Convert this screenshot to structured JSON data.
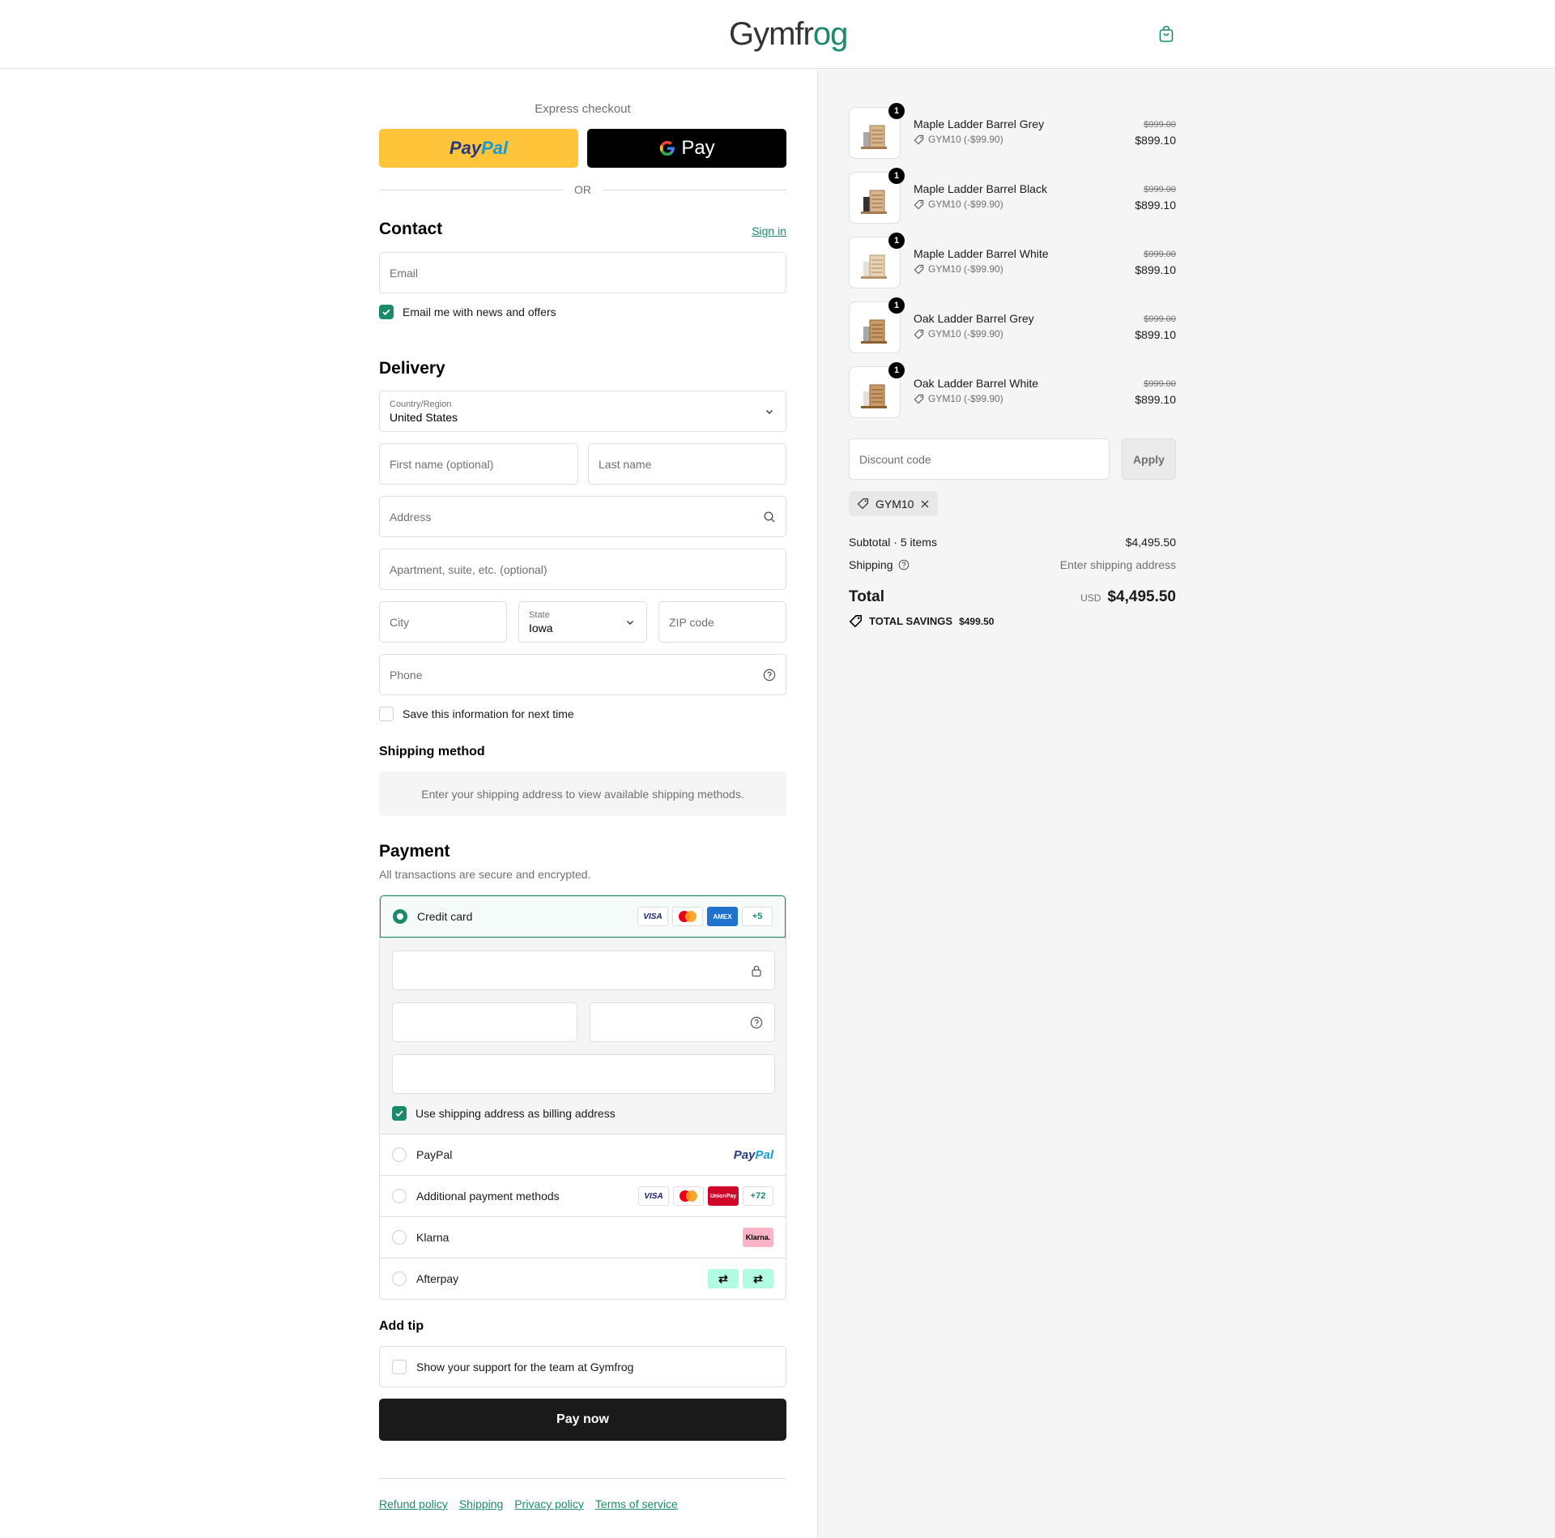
{
  "header": {
    "brand_prefix": "Gymfr",
    "brand_suffix": "og",
    "cart_icon": "shopping-bag-icon"
  },
  "express": {
    "label": "Express checkout",
    "paypal_part1": "Pay",
    "paypal_part2": "Pal",
    "gpay_label": "Pay",
    "or_text": "OR"
  },
  "contact": {
    "title": "Contact",
    "sign_in": "Sign in",
    "email_placeholder": "Email",
    "newsletter_label": "Email me with news and offers",
    "newsletter_checked": true
  },
  "delivery": {
    "title": "Delivery",
    "country_label": "Country/Region",
    "country_value": "United States",
    "first_name_placeholder": "First name (optional)",
    "last_name_placeholder": "Last name",
    "address_placeholder": "Address",
    "apartment_placeholder": "Apartment, suite, etc. (optional)",
    "city_placeholder": "City",
    "state_label": "State",
    "state_value": "Iowa",
    "zip_placeholder": "ZIP code",
    "phone_placeholder": "Phone",
    "save_info_label": "Save this information for next time",
    "save_info_checked": false
  },
  "shipping_method": {
    "title": "Shipping method",
    "message": "Enter your shipping address to view available shipping methods."
  },
  "payment": {
    "title": "Payment",
    "note": "All transactions are secure and encrypted.",
    "credit_card_label": "Credit card",
    "credit_card_more": "+5",
    "billing_label": "Use shipping address as billing address",
    "billing_checked": true,
    "paypal_label": "PayPal",
    "paypal_brand": "PayPal",
    "additional_label": "Additional payment methods",
    "additional_more": "+72",
    "klarna_label": "Klarna",
    "klarna_brand": "Klarna.",
    "afterpay_label": "Afterpay",
    "visa": "VISA",
    "amex": "AMEX",
    "unionpay": "UnionPay"
  },
  "tip": {
    "title": "Add tip",
    "label": "Show your support for the team at Gymfrog"
  },
  "pay_now": "Pay now",
  "footer_links": [
    "Refund policy",
    "Shipping",
    "Privacy policy",
    "Terms of service"
  ],
  "order": {
    "items": [
      {
        "name": "Maple Ladder Barrel Grey",
        "discount": "GYM10 (-$99.90)",
        "original": "$999.00",
        "price": "$899.10",
        "qty": "1"
      },
      {
        "name": "Maple Ladder Barrel Black",
        "discount": "GYM10 (-$99.90)",
        "original": "$999.00",
        "price": "$899.10",
        "qty": "1"
      },
      {
        "name": "Maple Ladder Barrel White",
        "discount": "GYM10 (-$99.90)",
        "original": "$999.00",
        "price": "$899.10",
        "qty": "1"
      },
      {
        "name": "Oak Ladder Barrel Grey",
        "discount": "GYM10 (-$99.90)",
        "original": "$999.00",
        "price": "$899.10",
        "qty": "1"
      },
      {
        "name": "Oak Ladder Barrel White",
        "discount": "GYM10 (-$99.90)",
        "original": "$999.00",
        "price": "$899.10",
        "qty": "1"
      }
    ],
    "discount_placeholder": "Discount code",
    "apply_label": "Apply",
    "applied_code": "GYM10",
    "subtotal_label": "Subtotal · 5 items",
    "subtotal_value": "$4,495.50",
    "shipping_label": "Shipping",
    "shipping_value": "Enter shipping address",
    "total_label": "Total",
    "currency": "USD",
    "total_value": "$4,495.50",
    "savings_label": "TOTAL SAVINGS",
    "savings_value": "$499.50"
  },
  "colors": {
    "accent": "#1b8a6b",
    "paypal_yellow": "#ffc439",
    "dark": "#1a1a1a"
  }
}
